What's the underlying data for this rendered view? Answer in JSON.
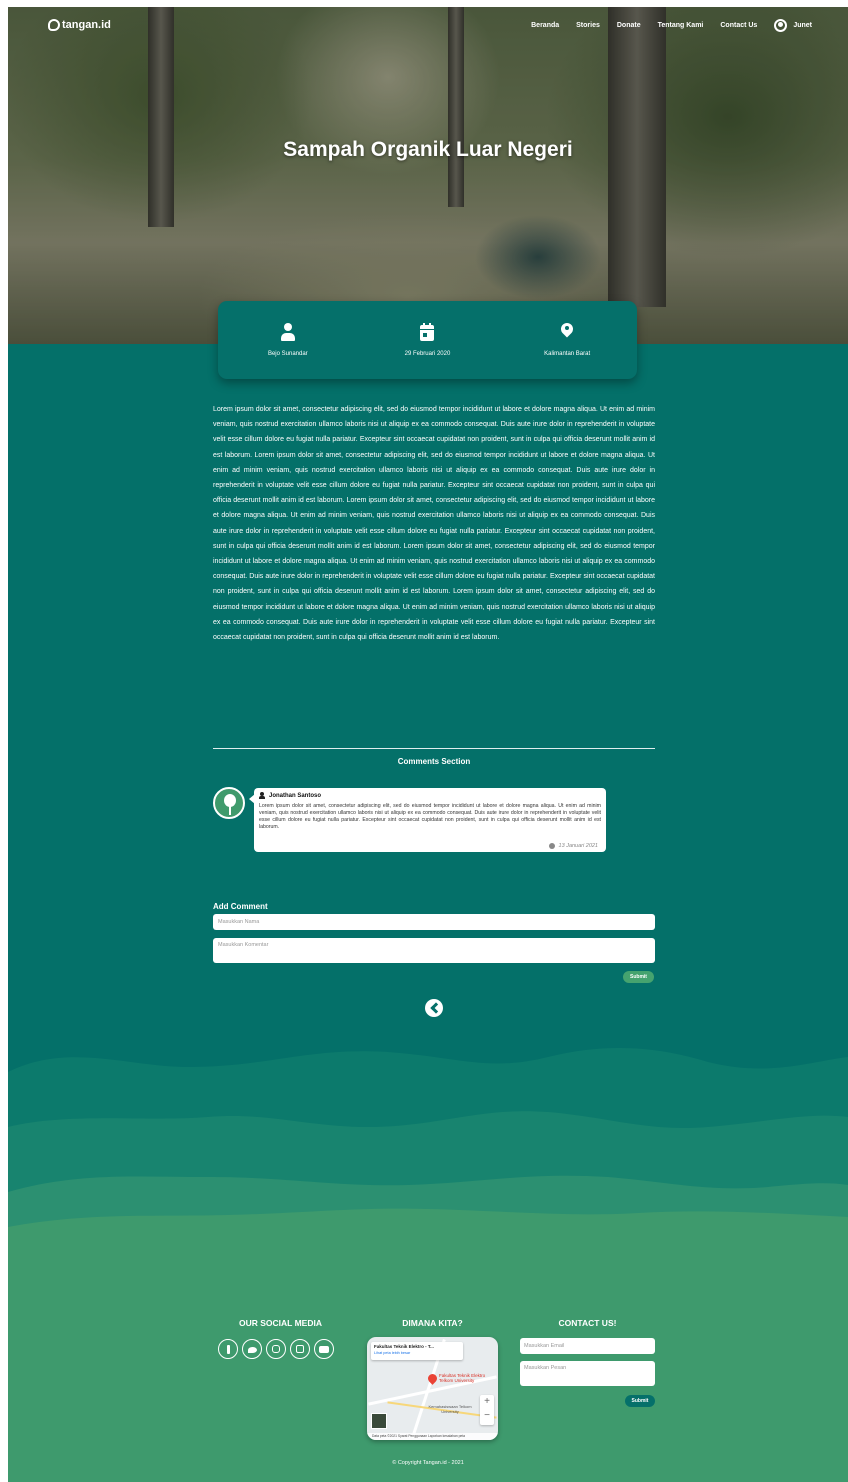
{
  "nav": {
    "logo_text": "tangan.id",
    "links": [
      "Beranda",
      "Stories",
      "Donate",
      "Tentang Kami",
      "Contact Us"
    ],
    "user_name": "Junet"
  },
  "hero": {
    "title": "Sampah Organik Luar Negeri"
  },
  "info": {
    "author": "Bejo Sunandar",
    "date": "29 Februari 2020",
    "location": "Kalimantan Barat"
  },
  "article": {
    "body": "Lorem ipsum dolor sit amet, consectetur adipiscing elit, sed do eiusmod tempor incididunt ut labore et dolore magna aliqua. Ut enim ad minim veniam, quis nostrud exercitation ullamco laboris nisi ut aliquip ex ea commodo consequat. Duis aute irure dolor in reprehenderit in voluptate velit esse cillum dolore eu fugiat nulla pariatur. Excepteur sint occaecat cupidatat non proident, sunt in culpa qui officia deserunt mollit anim id est laborum. Lorem ipsum dolor sit amet, consectetur adipiscing elit, sed do eiusmod tempor incididunt ut labore et dolore magna aliqua. Ut enim ad minim veniam, quis nostrud exercitation ullamco laboris nisi ut aliquip ex ea commodo consequat. Duis aute irure dolor in reprehenderit in voluptate velit esse cillum dolore eu fugiat nulla pariatur. Excepteur sint occaecat cupidatat non proident, sunt in culpa qui officia deserunt mollit anim id est laborum. Lorem ipsum dolor sit amet, consectetur adipiscing elit, sed do eiusmod tempor incididunt ut labore et dolore magna aliqua. Ut enim ad minim veniam, quis nostrud exercitation ullamco laboris nisi ut aliquip ex ea commodo consequat. Duis aute irure dolor in reprehenderit in voluptate velit esse cillum dolore eu fugiat nulla pariatur. Excepteur sint occaecat cupidatat non proident, sunt in culpa qui officia deserunt mollit anim id est laborum. Lorem ipsum dolor sit amet, consectetur adipiscing elit, sed do eiusmod tempor incididunt ut labore et dolore magna aliqua. Ut enim ad minim veniam, quis nostrud exercitation ullamco laboris nisi ut aliquip ex ea commodo consequat. Duis aute irure dolor in reprehenderit in voluptate velit esse cillum dolore eu fugiat nulla pariatur. Excepteur sint occaecat cupidatat non proident, sunt in culpa qui officia deserunt mollit anim id est laborum. Lorem ipsum dolor sit amet, consectetur adipiscing elit, sed do eiusmod tempor incididunt ut labore et dolore magna aliqua. Ut enim ad minim veniam, quis nostrud exercitation ullamco laboris nisi ut aliquip ex ea commodo consequat. Duis aute irure dolor in reprehenderit in voluptate velit esse cillum dolore eu fugiat nulla pariatur. Excepteur sint occaecat cupidatat non proident, sunt in culpa qui officia deserunt mollit anim id est laborum."
  },
  "comments": {
    "title": "Comments Section",
    "items": [
      {
        "author": "Jonathan Santoso",
        "text": "Lorem ipsum dolor sit amet, consectetur adipiscing elit, sed do eiusmod tempor incididunt ut labore et dolore magna aliqua. Ut enim ad minim veniam, quis nostrud exercitation ullamco laboris nisi ut aliquip ex ea commodo consequat. Duis aute irure dolor in reprehenderit in voluptate velit esse cillum dolore eu fugiat nulla pariatur. Excepteur sint occaecat cupidatat non proident, sunt in culpa qui officia deserunt mollit anim id est laborum.",
        "date": "13 Januari 2021"
      }
    ]
  },
  "add_comment": {
    "title": "Add Comment",
    "name_placeholder": "Masukkan Nama",
    "comment_placeholder": "Masukkan Komentar",
    "submit_label": "Submit"
  },
  "footer": {
    "social_title": "OUR SOCIAL MEDIA",
    "social_icons": [
      "facebook-icon",
      "twitter-icon",
      "instagram-icon",
      "line-icon",
      "youtube-icon"
    ],
    "map_title": "DIMANA KITA?",
    "map": {
      "place_name": "Fakultas Teknik Elektro - T...",
      "view_larger": "Lihat peta lebih besar",
      "pin_label": "Fakultas Teknik Elektro Telkom University",
      "secondary_label": "Kemahasiswaan Telkom University",
      "footer_text": "Data peta ©2021   Syarat Penggunaan   Laporkan kesalahan peta"
    },
    "contact_title": "CONTACT US!",
    "email_placeholder": "Masukkan Email",
    "message_placeholder": "Masukkan Pesan",
    "submit_label": "Submit",
    "copyright": "© Copyright Tangan.id - 2021"
  },
  "colors": {
    "primary": "#05706a",
    "accent": "#45a36f",
    "wave_light": "#3e9a6d"
  }
}
